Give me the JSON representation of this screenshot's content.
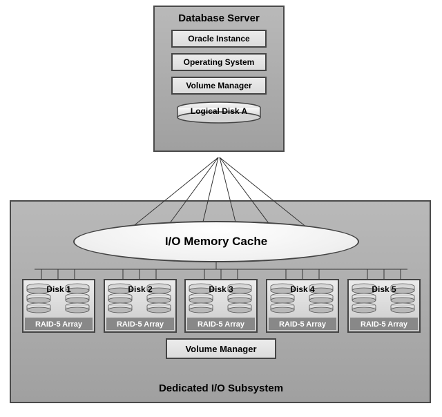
{
  "server": {
    "title": "Database Server",
    "layers": [
      "Oracle Instance",
      "Operating System",
      "Volume Manager"
    ],
    "logical_disk": "Logical Disk A"
  },
  "subsystem": {
    "title": "Dedicated I/O Subsystem",
    "cache": "I/O Memory Cache",
    "volume_manager": "Volume Manager",
    "disks": [
      {
        "name": "Disk 1",
        "raid": "RAID-5 Array"
      },
      {
        "name": "Disk 2",
        "raid": "RAID-5 Array"
      },
      {
        "name": "Disk 3",
        "raid": "RAID-5 Array"
      },
      {
        "name": "Disk 4",
        "raid": "RAID-5 Array"
      },
      {
        "name": "Disk 5",
        "raid": "RAID-5 Array"
      }
    ]
  }
}
